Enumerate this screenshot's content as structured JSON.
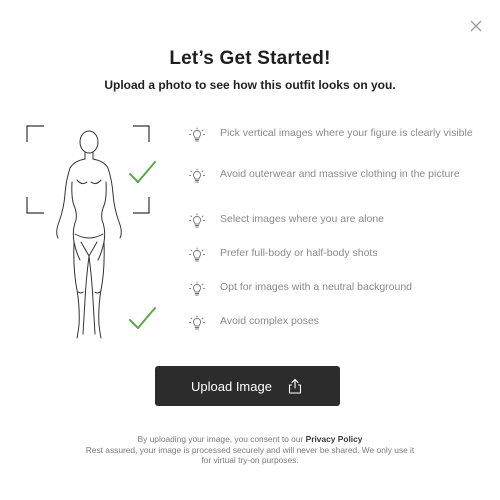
{
  "modal": {
    "title": "Let’s Get Started!",
    "subtitle": "Upload a photo to see how this outfit looks on you."
  },
  "icons": {
    "close": "close-icon",
    "tip": "lightbulb-icon",
    "check": "checkmark-icon",
    "upload": "upload-icon",
    "figure": "body-silhouette-illustration"
  },
  "colors": {
    "check": "#5aa84a",
    "button_bg": "#2c2c2c",
    "tip_text": "#8a8a8a"
  },
  "tips": [
    "Pick vertical images where your figure is clearly visible",
    "Avoid outerwear and massive clothing in the picture",
    "Select images where you are alone",
    "Prefer full-body or half-body shots",
    "Opt for images with a neutral background",
    "Avoid complex poses"
  ],
  "upload_button": {
    "label": "Upload Image"
  },
  "consent": {
    "prefix": "By uploading your image, you consent to our",
    "policy_link": "Privacy Policy",
    "line2": "Rest assured, your image is processed securely and will never be shared. We only use it",
    "line3": "for virtual try-on purposes."
  }
}
